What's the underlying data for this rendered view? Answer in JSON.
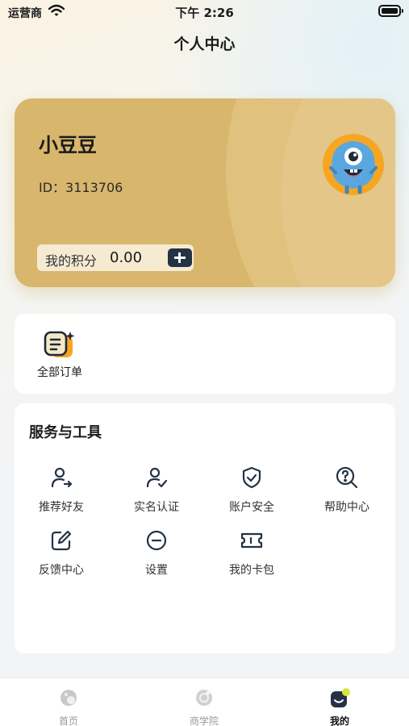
{
  "status_bar": {
    "carrier": "运营商",
    "time": "下午 2:26"
  },
  "page": {
    "title": "个人中心"
  },
  "member_card": {
    "nickname": "小豆豆",
    "id_text": "ID：3113706",
    "points_label": "我的积分",
    "points_value": "0.00"
  },
  "orders": {
    "all_orders_label": "全部订单"
  },
  "services": {
    "title": "服务与工具",
    "items": [
      {
        "label": "推荐好友",
        "icon": "invite-user-icon"
      },
      {
        "label": "实名认证",
        "icon": "verify-user-icon"
      },
      {
        "label": "账户安全",
        "icon": "shield-icon"
      },
      {
        "label": "帮助中心",
        "icon": "help-search-icon"
      },
      {
        "label": "反馈中心",
        "icon": "edit-icon"
      },
      {
        "label": "设置",
        "icon": "minus-circle-icon"
      },
      {
        "label": "我的卡包",
        "icon": "ticket-icon"
      }
    ]
  },
  "tabbar": {
    "items": [
      {
        "label": "首页",
        "icon": "home-planet-icon",
        "active": false
      },
      {
        "label": "商学院",
        "icon": "academy-planet-icon",
        "active": false
      },
      {
        "label": "我的",
        "icon": "mine-face-icon",
        "active": true
      }
    ]
  },
  "colors": {
    "card_gold": "#d8b66c",
    "accent_orange": "#f6a623",
    "icon_dark": "#243244",
    "tab_active_dot": "#d6e640"
  }
}
